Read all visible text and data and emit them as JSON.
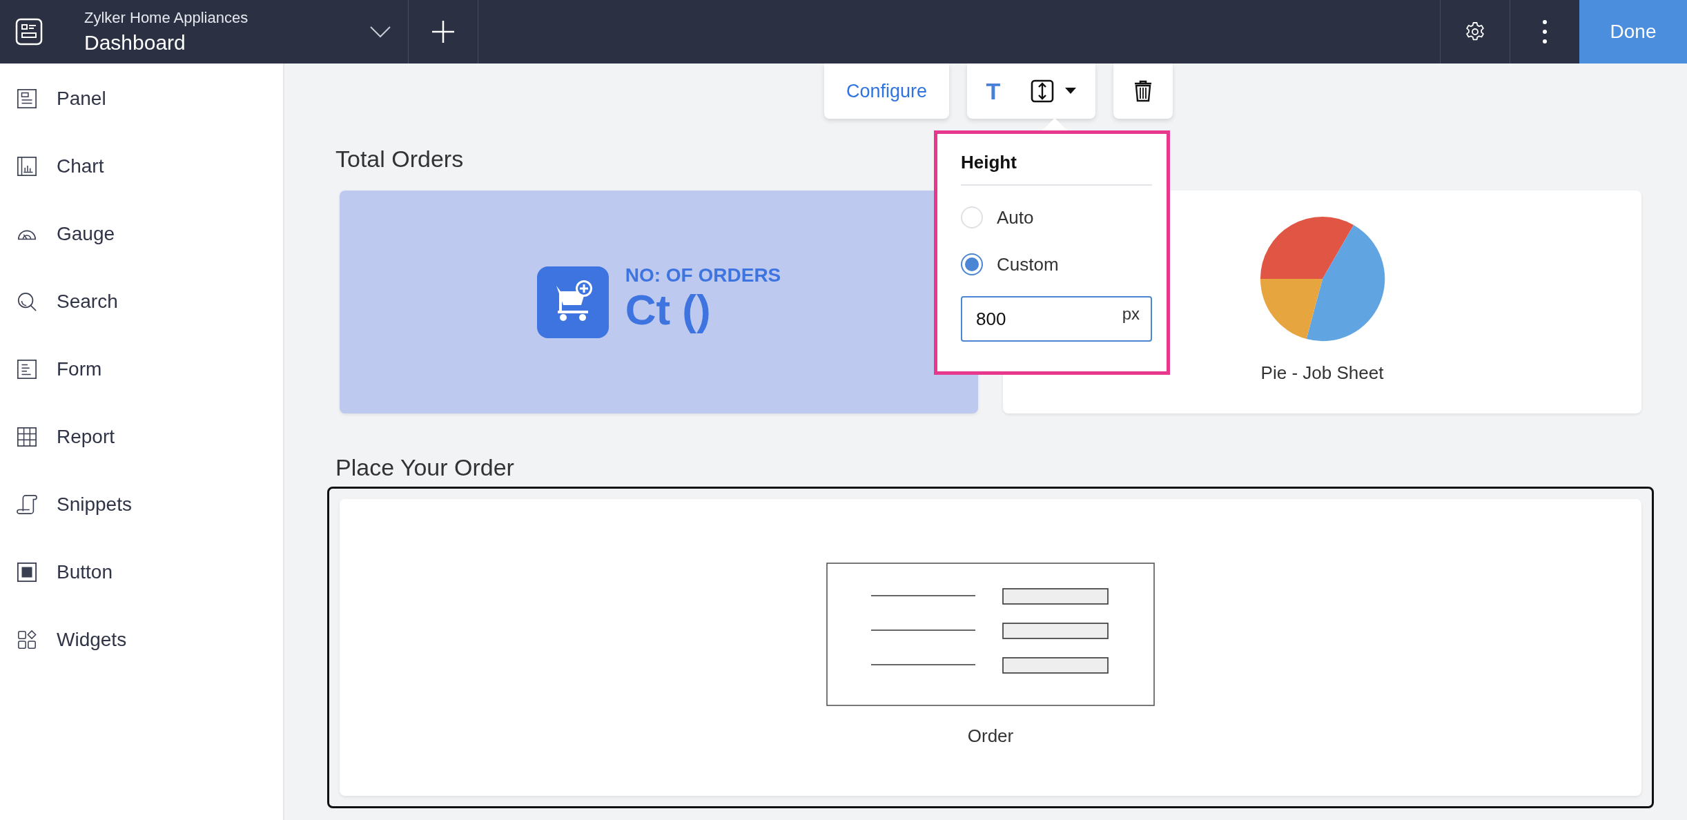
{
  "app_bar": {
    "subtitle": "Zylker Home Appliances",
    "title": "Dashboard",
    "done_button": "Done"
  },
  "sidebar": {
    "items": [
      {
        "label": "Panel",
        "kind": "panel"
      },
      {
        "label": "Chart",
        "kind": "chart"
      },
      {
        "label": "Gauge",
        "kind": "gauge"
      },
      {
        "label": "Search",
        "kind": "search"
      },
      {
        "label": "Form",
        "kind": "form"
      },
      {
        "label": "Report",
        "kind": "report"
      },
      {
        "label": "Snippets",
        "kind": "snippets"
      },
      {
        "label": "Button",
        "kind": "button"
      },
      {
        "label": "Widgets",
        "kind": "widgets"
      }
    ]
  },
  "toolbar": {
    "configure_button": "Configure",
    "text_button": "T"
  },
  "height_popup": {
    "title": "Height",
    "options": [
      {
        "label": "Auto",
        "selected": false
      },
      {
        "label": "Custom",
        "selected": true
      }
    ],
    "value": "800",
    "unit": "px"
  },
  "sections": [
    {
      "title": "Total Orders",
      "selected": false,
      "cards": [
        {
          "kind": "kpi",
          "label": "NO: OF ORDERS",
          "value": "Ct ()"
        },
        {
          "kind": "pie",
          "caption": "Pie - Job Sheet"
        }
      ]
    },
    {
      "title": "Place Your Order",
      "selected": true,
      "cards": [
        {
          "kind": "form",
          "caption": "Order"
        }
      ]
    }
  ]
}
